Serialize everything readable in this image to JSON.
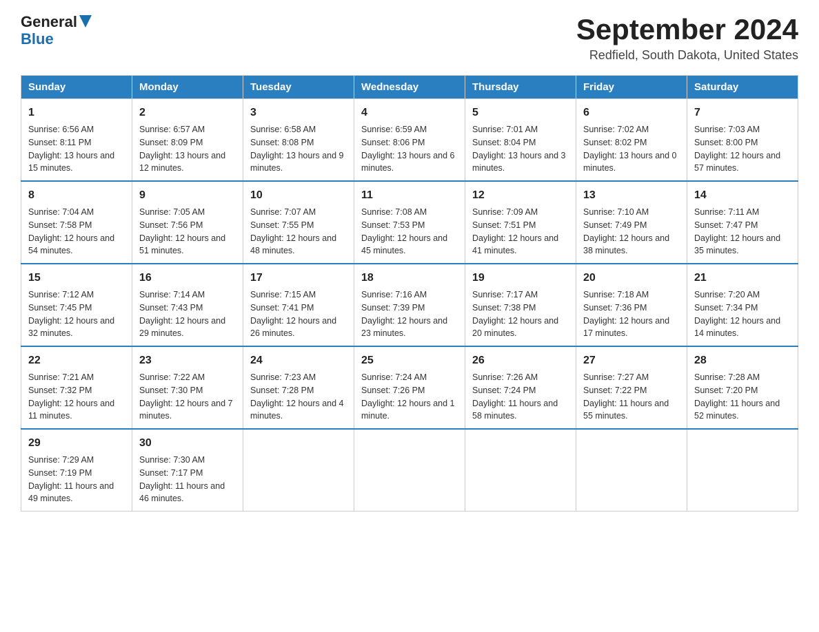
{
  "header": {
    "logo_general": "General",
    "logo_blue": "Blue",
    "month_year": "September 2024",
    "location": "Redfield, South Dakota, United States"
  },
  "days_of_week": [
    "Sunday",
    "Monday",
    "Tuesday",
    "Wednesday",
    "Thursday",
    "Friday",
    "Saturday"
  ],
  "weeks": [
    [
      {
        "day": "1",
        "sunrise": "6:56 AM",
        "sunset": "8:11 PM",
        "daylight": "13 hours and 15 minutes."
      },
      {
        "day": "2",
        "sunrise": "6:57 AM",
        "sunset": "8:09 PM",
        "daylight": "13 hours and 12 minutes."
      },
      {
        "day": "3",
        "sunrise": "6:58 AM",
        "sunset": "8:08 PM",
        "daylight": "13 hours and 9 minutes."
      },
      {
        "day": "4",
        "sunrise": "6:59 AM",
        "sunset": "8:06 PM",
        "daylight": "13 hours and 6 minutes."
      },
      {
        "day": "5",
        "sunrise": "7:01 AM",
        "sunset": "8:04 PM",
        "daylight": "13 hours and 3 minutes."
      },
      {
        "day": "6",
        "sunrise": "7:02 AM",
        "sunset": "8:02 PM",
        "daylight": "13 hours and 0 minutes."
      },
      {
        "day": "7",
        "sunrise": "7:03 AM",
        "sunset": "8:00 PM",
        "daylight": "12 hours and 57 minutes."
      }
    ],
    [
      {
        "day": "8",
        "sunrise": "7:04 AM",
        "sunset": "7:58 PM",
        "daylight": "12 hours and 54 minutes."
      },
      {
        "day": "9",
        "sunrise": "7:05 AM",
        "sunset": "7:56 PM",
        "daylight": "12 hours and 51 minutes."
      },
      {
        "day": "10",
        "sunrise": "7:07 AM",
        "sunset": "7:55 PM",
        "daylight": "12 hours and 48 minutes."
      },
      {
        "day": "11",
        "sunrise": "7:08 AM",
        "sunset": "7:53 PM",
        "daylight": "12 hours and 45 minutes."
      },
      {
        "day": "12",
        "sunrise": "7:09 AM",
        "sunset": "7:51 PM",
        "daylight": "12 hours and 41 minutes."
      },
      {
        "day": "13",
        "sunrise": "7:10 AM",
        "sunset": "7:49 PM",
        "daylight": "12 hours and 38 minutes."
      },
      {
        "day": "14",
        "sunrise": "7:11 AM",
        "sunset": "7:47 PM",
        "daylight": "12 hours and 35 minutes."
      }
    ],
    [
      {
        "day": "15",
        "sunrise": "7:12 AM",
        "sunset": "7:45 PM",
        "daylight": "12 hours and 32 minutes."
      },
      {
        "day": "16",
        "sunrise": "7:14 AM",
        "sunset": "7:43 PM",
        "daylight": "12 hours and 29 minutes."
      },
      {
        "day": "17",
        "sunrise": "7:15 AM",
        "sunset": "7:41 PM",
        "daylight": "12 hours and 26 minutes."
      },
      {
        "day": "18",
        "sunrise": "7:16 AM",
        "sunset": "7:39 PM",
        "daylight": "12 hours and 23 minutes."
      },
      {
        "day": "19",
        "sunrise": "7:17 AM",
        "sunset": "7:38 PM",
        "daylight": "12 hours and 20 minutes."
      },
      {
        "day": "20",
        "sunrise": "7:18 AM",
        "sunset": "7:36 PM",
        "daylight": "12 hours and 17 minutes."
      },
      {
        "day": "21",
        "sunrise": "7:20 AM",
        "sunset": "7:34 PM",
        "daylight": "12 hours and 14 minutes."
      }
    ],
    [
      {
        "day": "22",
        "sunrise": "7:21 AM",
        "sunset": "7:32 PM",
        "daylight": "12 hours and 11 minutes."
      },
      {
        "day": "23",
        "sunrise": "7:22 AM",
        "sunset": "7:30 PM",
        "daylight": "12 hours and 7 minutes."
      },
      {
        "day": "24",
        "sunrise": "7:23 AM",
        "sunset": "7:28 PM",
        "daylight": "12 hours and 4 minutes."
      },
      {
        "day": "25",
        "sunrise": "7:24 AM",
        "sunset": "7:26 PM",
        "daylight": "12 hours and 1 minute."
      },
      {
        "day": "26",
        "sunrise": "7:26 AM",
        "sunset": "7:24 PM",
        "daylight": "11 hours and 58 minutes."
      },
      {
        "day": "27",
        "sunrise": "7:27 AM",
        "sunset": "7:22 PM",
        "daylight": "11 hours and 55 minutes."
      },
      {
        "day": "28",
        "sunrise": "7:28 AM",
        "sunset": "7:20 PM",
        "daylight": "11 hours and 52 minutes."
      }
    ],
    [
      {
        "day": "29",
        "sunrise": "7:29 AM",
        "sunset": "7:19 PM",
        "daylight": "11 hours and 49 minutes."
      },
      {
        "day": "30",
        "sunrise": "7:30 AM",
        "sunset": "7:17 PM",
        "daylight": "11 hours and 46 minutes."
      },
      null,
      null,
      null,
      null,
      null
    ]
  ]
}
